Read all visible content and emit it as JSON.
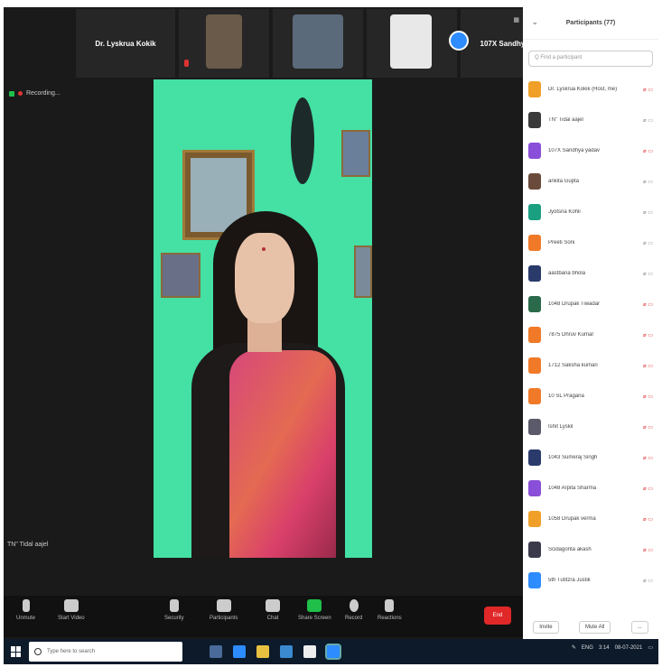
{
  "colors": {
    "accent": "#2d8cff",
    "end": "#e02828",
    "green": "#1fbf4a",
    "panel_bg": "#ffffff"
  },
  "thumbnails": [
    {
      "name": "Dr. Lyskrua Kokik",
      "type": "name"
    },
    {
      "name": "",
      "type": "video",
      "caption": ""
    },
    {
      "name": "",
      "type": "video",
      "caption": ""
    },
    {
      "name": "",
      "type": "video",
      "caption": ""
    },
    {
      "name": "107X Sandhya y...",
      "type": "name"
    }
  ],
  "recording_label": "Recording...",
  "active_speaker": "TN\" Tidal aajel",
  "toolbar": [
    {
      "label": "Unmute",
      "icon": "mic-icon"
    },
    {
      "label": "Start Video",
      "icon": "video-icon"
    },
    {
      "label": "Security",
      "icon": "shield-icon"
    },
    {
      "label": "Participants",
      "icon": "participants-icon"
    },
    {
      "label": "Chat",
      "icon": "chat-icon"
    },
    {
      "label": "Share Screen",
      "icon": "share-icon"
    },
    {
      "label": "Record",
      "icon": "record-icon"
    },
    {
      "label": "Reactions",
      "icon": "reaction-icon"
    }
  ],
  "end_label": "End",
  "panel": {
    "title": "Participants (77)",
    "search_placeholder": "Q Find a participant",
    "participants": [
      {
        "name": "Dr. Lyskrua Kokik (Host, me)",
        "color": "#f0a028",
        "muted": true
      },
      {
        "name": "TN\" Tidal aajel",
        "color": "#3a3a3a",
        "muted": false
      },
      {
        "name": "107X Sandhya yadav",
        "color": "#8a4fd8",
        "muted": true
      },
      {
        "name": "ankita Gupta",
        "color": "#6a4a3a",
        "muted": false
      },
      {
        "name": "Jyotsna Kohli",
        "color": "#1aa080",
        "muted": false
      },
      {
        "name": "Preeti Soni",
        "color": "#f07a28",
        "muted": false
      },
      {
        "name": "aastbana bhola",
        "color": "#2a3a6a",
        "muted": false
      },
      {
        "name": "1048 Drupak Tiwadar",
        "color": "#2a6a4a",
        "muted": true
      },
      {
        "name": "7875 Dhruv Kumar",
        "color": "#f07a28",
        "muted": true
      },
      {
        "name": "1712 Saksha kumari",
        "color": "#f07a28",
        "muted": true
      },
      {
        "name": "10 SL Pragana",
        "color": "#f07a28",
        "muted": true
      },
      {
        "name": "Ishit Lyskil",
        "color": "#5a5a6a",
        "muted": true
      },
      {
        "name": "1043 Sumeraj Singh",
        "color": "#2a3a6a",
        "muted": true
      },
      {
        "name": "1048 Arpita Sharma",
        "color": "#8a4fd8",
        "muted": true
      },
      {
        "name": "1058 Drupak verma",
        "color": "#f0a028",
        "muted": true
      },
      {
        "name": "Scidagonta akash",
        "color": "#3a3a4a",
        "muted": true
      },
      {
        "name": "5th Tutitzra Justik",
        "color": "#2d8cff",
        "muted": false
      }
    ],
    "invite_label": "Invite",
    "mute_all_label": "Mute All",
    "more_label": "..."
  },
  "taskbar": {
    "search_placeholder": "Type here to search",
    "time": "3:14",
    "date": "08-07-2021",
    "lang": "ENG"
  }
}
